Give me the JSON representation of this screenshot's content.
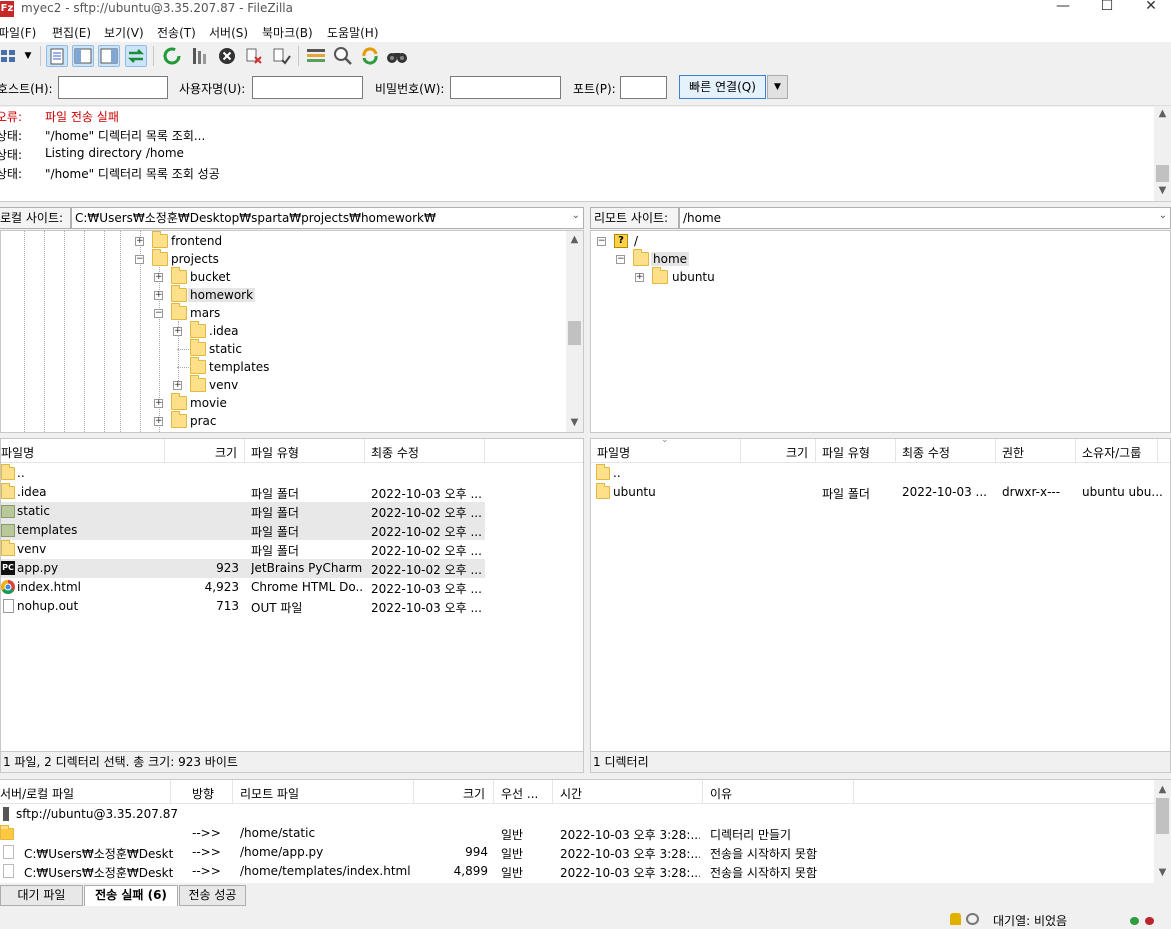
{
  "window": {
    "title": "myec2 - sftp://ubuntu@3.35.207.87 - FileZilla",
    "app_icon": "Fz"
  },
  "menu": [
    "파일(F)",
    "편집(E)",
    "보기(V)",
    "전송(T)",
    "서버(S)",
    "북마크(B)",
    "도움말(H)"
  ],
  "quickconnect": {
    "host_label": "호스트(H):",
    "host_value": "",
    "user_label": "사용자명(U):",
    "user_value": "",
    "pass_label": "비밀번호(W):",
    "pass_value": "",
    "port_label": "포트(P):",
    "port_value": "",
    "button": "빠른 연결(Q)"
  },
  "log": [
    {
      "type": "오류:",
      "msg": "파일 전송 실패",
      "error": true
    },
    {
      "type": "상태:",
      "msg": "\"/home\" 디렉터리 목록 조회..."
    },
    {
      "type": "상태:",
      "msg": "Listing directory /home"
    },
    {
      "type": "상태:",
      "msg": "\"/home\" 디렉터리 목록 조회 성공"
    }
  ],
  "local": {
    "site_label": "로컬 사이트:",
    "path": "C:₩Users₩소정훈₩Desktop₩sparta₩projects₩homework₩",
    "tree": [
      "frontend",
      "projects",
      "bucket",
      "homework",
      "mars",
      ".idea",
      "static",
      "templates",
      "venv",
      "movie",
      "prac"
    ],
    "columns": [
      "파일명",
      "크기",
      "파일 유형",
      "최종 수정"
    ],
    "files": [
      {
        "name": "..",
        "size": "",
        "type": "",
        "modified": ""
      },
      {
        "name": ".idea",
        "size": "",
        "type": "파일 폴더",
        "modified": "2022-10-03 오후 ..."
      },
      {
        "name": "static",
        "size": "",
        "type": "파일 폴더",
        "modified": "2022-10-02 오후 ..."
      },
      {
        "name": "templates",
        "size": "",
        "type": "파일 폴더",
        "modified": "2022-10-02 오후 ..."
      },
      {
        "name": "venv",
        "size": "",
        "type": "파일 폴더",
        "modified": "2022-10-02 오후 ..."
      },
      {
        "name": "app.py",
        "size": "923",
        "type": "JetBrains PyCharm",
        "modified": "2022-10-02 오후 ..."
      },
      {
        "name": "index.html",
        "size": "4,923",
        "type": "Chrome HTML Do...",
        "modified": "2022-10-03 오후 ..."
      },
      {
        "name": "nohup.out",
        "size": "713",
        "type": "OUT 파일",
        "modified": "2022-10-03 오후 ..."
      }
    ],
    "status": "1 파일, 2 디렉터리 선택. 총 크기: 923 바이트"
  },
  "remote": {
    "site_label": "리모트 사이트:",
    "path": "/home",
    "tree": [
      "/",
      "home",
      "ubuntu"
    ],
    "columns": [
      "파일명",
      "크기",
      "파일 유형",
      "최종 수정",
      "권한",
      "소유자/그룹"
    ],
    "files": [
      {
        "name": "..",
        "size": "",
        "type": "",
        "modified": "",
        "perms": "",
        "owner": ""
      },
      {
        "name": "ubuntu",
        "size": "",
        "type": "파일 폴더",
        "modified": "2022-10-03 ...",
        "perms": "drwxr-x---",
        "owner": "ubuntu ubu..."
      }
    ],
    "status": "1 디렉터리"
  },
  "queue": {
    "columns": [
      "서버/로컬 파일",
      "방향",
      "리모트 파일",
      "크기",
      "우선 ...",
      "시간",
      "이유"
    ],
    "server": "sftp://ubuntu@3.35.207.87",
    "rows": [
      {
        "local": "",
        "dir": "-->>",
        "remote": "/home/static",
        "size": "",
        "priority": "일반",
        "time": "2022-10-03 오후 3:28:...",
        "reason": "디렉터리 만들기"
      },
      {
        "local": "C:₩Users₩소정훈₩Deskto...",
        "dir": "-->>",
        "remote": "/home/app.py",
        "size": "994",
        "priority": "일반",
        "time": "2022-10-03 오후 3:28:...",
        "reason": "전송을 시작하지 못함"
      },
      {
        "local": "C:₩Users₩소정훈₩Deskto...",
        "dir": "-->>",
        "remote": "/home/templates/index.html",
        "size": "4,899",
        "priority": "일반",
        "time": "2022-10-03 오후 3:28:...",
        "reason": "전송을 시작하지 못함"
      }
    ],
    "tabs": [
      "대기 파일",
      "전송 실패 (6)",
      "전송 성공"
    ]
  },
  "statusline": {
    "queue_text": "대기열: 비었음"
  },
  "colors": {
    "error": "#cc0000",
    "accent": "#3c7fd6",
    "folder": "#ffe08a"
  }
}
